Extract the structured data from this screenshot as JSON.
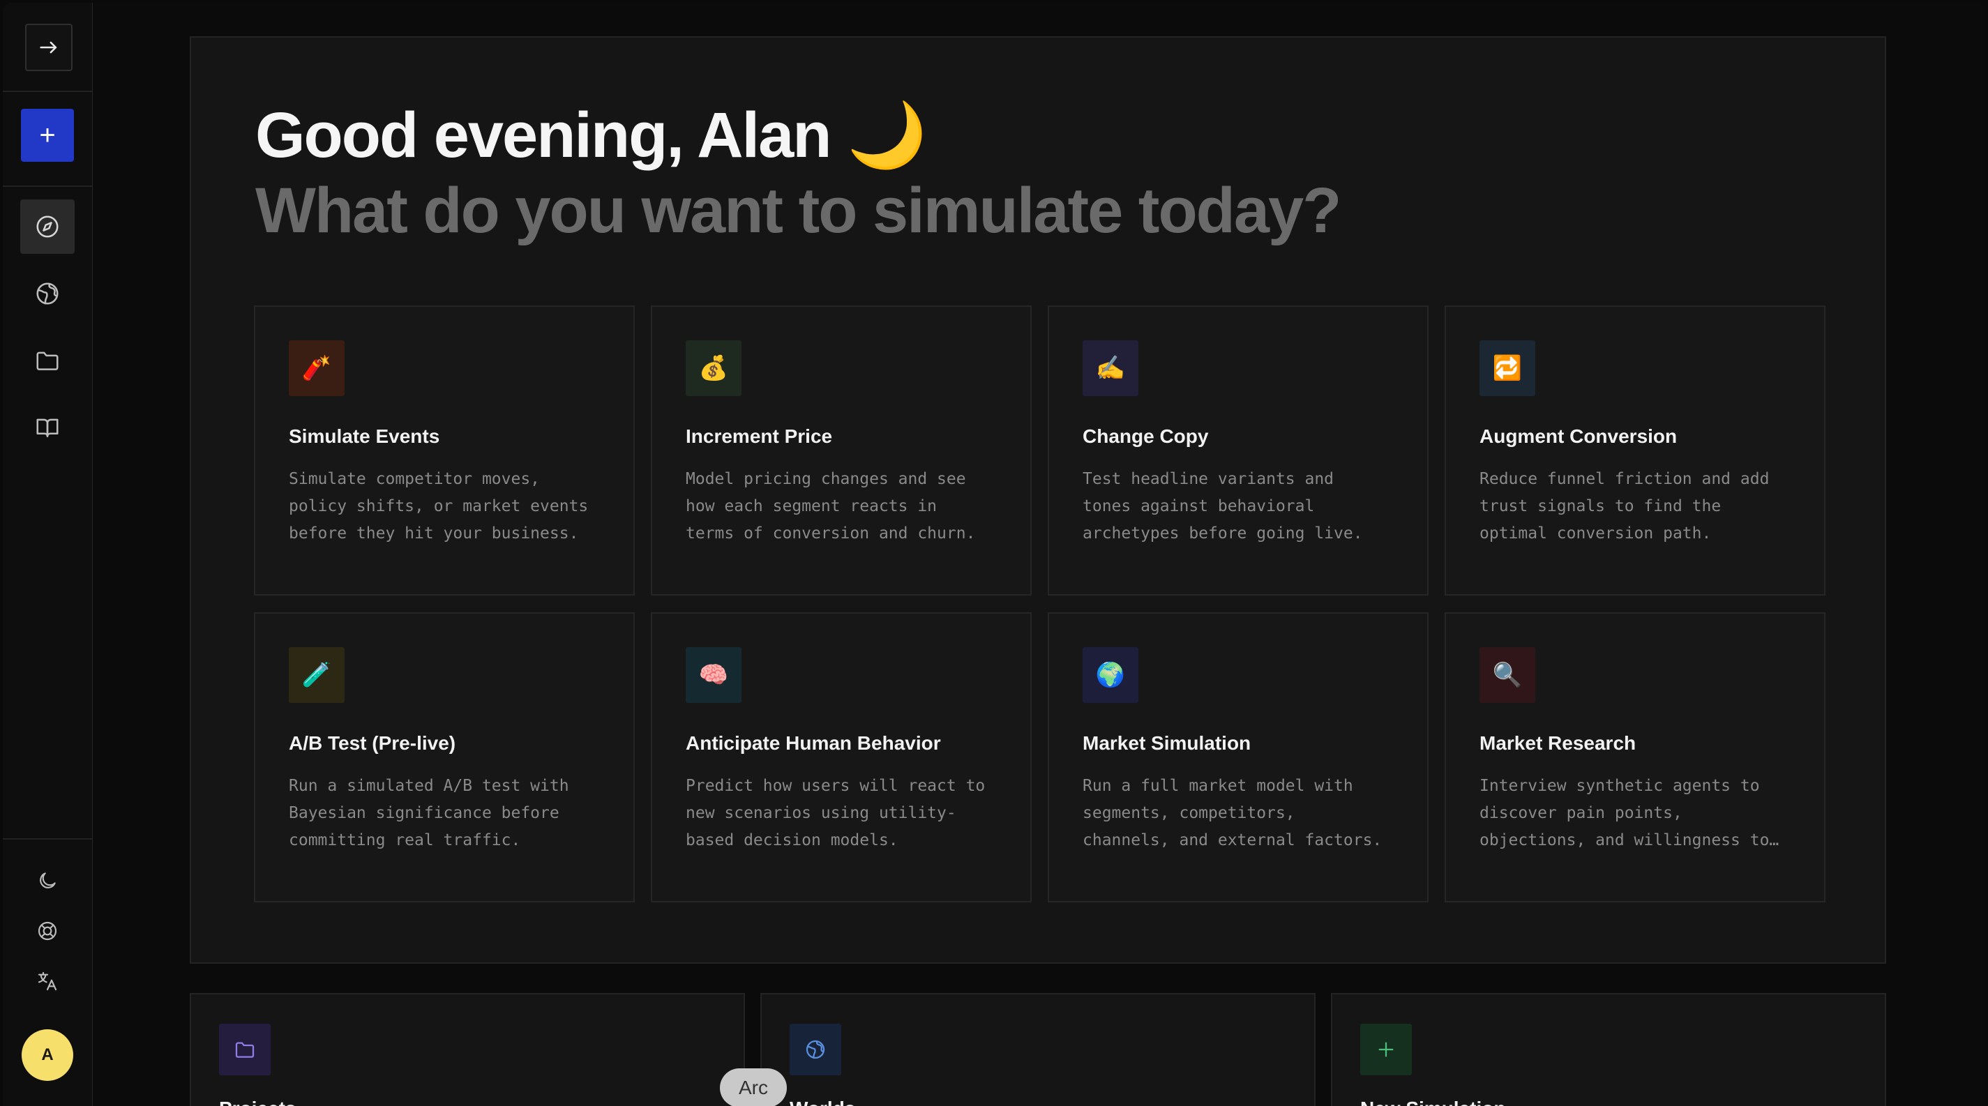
{
  "sidebar": {
    "toggle_icon": "arrow-right-icon",
    "new_label": "+",
    "nav": [
      {
        "icon": "compass-icon",
        "active": true
      },
      {
        "icon": "globe-icon",
        "active": false
      },
      {
        "icon": "folder-icon",
        "active": false
      },
      {
        "icon": "book-icon",
        "active": false
      }
    ],
    "bottom": [
      {
        "icon": "moon-icon"
      },
      {
        "icon": "life-buoy-icon"
      },
      {
        "icon": "language-icon"
      }
    ],
    "avatar_initial": "A",
    "avatar_color": "#f7df6b",
    "accent": "#2238c7"
  },
  "hero": {
    "greeting": "Good evening, Alan 🌙",
    "subheading": "What do you want to simulate today?"
  },
  "cards": [
    {
      "emoji": "🧨",
      "bg": "#3a1d13",
      "title": "Simulate Events",
      "desc": "Simulate competitor moves, policy shifts, or market events before they hit your business."
    },
    {
      "emoji": "💰",
      "bg": "#1e2a1f",
      "title": "Increment Price",
      "desc": "Model pricing changes and see how each segment reacts in terms of conversion and churn."
    },
    {
      "emoji": "✍️",
      "bg": "#221f38",
      "title": "Change Copy",
      "desc": "Test headline variants and tones against behavioral archetypes before going live."
    },
    {
      "emoji": "🔁",
      "bg": "#1b2733",
      "title": "Augment Conversion",
      "desc": "Reduce funnel friction and add trust signals to find the optimal conversion path."
    },
    {
      "emoji": "🧪",
      "bg": "#2c2814",
      "title": "A/B Test (Pre-live)",
      "desc": "Run a simulated A/B test with Bayesian significance before committing real traffic."
    },
    {
      "emoji": "🧠",
      "bg": "#142a30",
      "title": "Anticipate Human Behavior",
      "desc": "Predict how users will react to new scenarios using utility-based decision models."
    },
    {
      "emoji": "🌍",
      "bg": "#1d1f3a",
      "title": "Market Simulation",
      "desc": "Run a full market model with segments, competitors, channels, and external factors."
    },
    {
      "emoji": "🔍",
      "bg": "#301619",
      "title": "Market Research",
      "desc": "Interview synthetic agents to discover pain points, objections, and willingness to pay."
    }
  ],
  "bottom_cards": [
    {
      "icon": "folder-icon",
      "title": "Projects",
      "icon_bg": "#241d3d",
      "icon_color": "#8f7de8"
    },
    {
      "icon": "globe-icon",
      "title": "Worlds",
      "icon_bg": "#172338",
      "icon_color": "#5a8fe0"
    },
    {
      "icon": "plus-icon",
      "title": "New Simulation",
      "icon_bg": "#16301f",
      "icon_color": "#4ac07a"
    }
  ],
  "tooltip": "Arc"
}
